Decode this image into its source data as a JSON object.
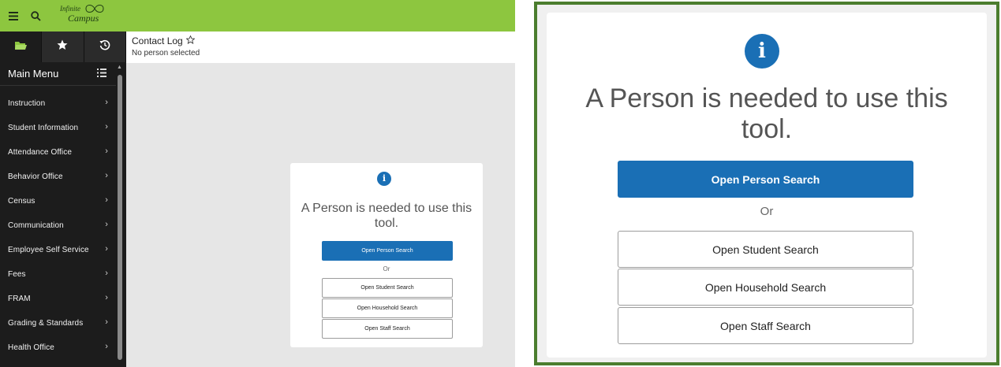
{
  "topbar": {
    "logo_line1": "Infinite",
    "logo_line2": "Campus",
    "accent_color": "#8dc63f"
  },
  "sidebar": {
    "tabs": [
      {
        "icon": "folder-icon"
      },
      {
        "icon": "star-icon"
      },
      {
        "icon": "history-icon"
      }
    ],
    "main_menu_label": "Main Menu",
    "items": [
      {
        "label": "Instruction"
      },
      {
        "label": "Student Information"
      },
      {
        "label": "Attendance Office"
      },
      {
        "label": "Behavior Office"
      },
      {
        "label": "Census"
      },
      {
        "label": "Communication"
      },
      {
        "label": "Employee Self Service"
      },
      {
        "label": "Fees"
      },
      {
        "label": "FRAM"
      },
      {
        "label": "Grading & Standards"
      },
      {
        "label": "Health Office"
      }
    ]
  },
  "content": {
    "title": "Contact Log",
    "subtitle": "No person selected"
  },
  "card": {
    "info_symbol": "i",
    "message": "A Person is needed to use this tool.",
    "primary_button": "Open Person Search",
    "or_text": "Or",
    "student_button": "Open Student Search",
    "household_button": "Open Household Search",
    "staff_button": "Open Staff Search",
    "button_color": "#1a6fb5"
  },
  "zoom_border_color": "#4b7d2e"
}
